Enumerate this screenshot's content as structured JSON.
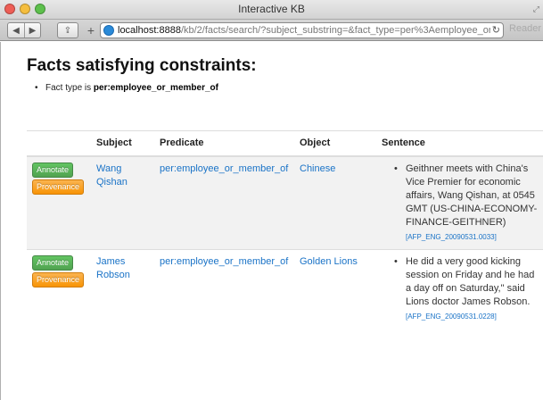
{
  "window": {
    "title": "Interactive KB"
  },
  "toolbar": {
    "back_icon": "◀",
    "forward_icon": "▶",
    "share_icon": "⇪",
    "add_tab_icon": "+",
    "url_host": "localhost:8888",
    "url_path": "/kb/2/facts/search/?subject_substring=&fact_type=per%3Aemployee_or_",
    "reload_icon": "↻",
    "reader_label": "Reader"
  },
  "page": {
    "heading": "Facts satisfying constraints:",
    "constraint_prefix": "Fact type is ",
    "constraint_value": "per:employee_or_member_of"
  },
  "table": {
    "headers": [
      "",
      "Subject",
      "Predicate",
      "Object",
      "Sentence"
    ],
    "rows": [
      {
        "annotate": "Annotate",
        "provenance": "Provenance",
        "subject": "Wang Qishan",
        "predicate": "per:employee_or_member_of",
        "object": "Chinese",
        "sentence": "Geithner meets with China's Vice Premier for economic affairs, Wang Qishan, at 0545 GMT (US-CHINA-ECONOMY-FINANCE-GEITHNER)",
        "doc": "[AFP_ENG_20090531.0033]"
      },
      {
        "annotate": "Annotate",
        "provenance": "Provenance",
        "subject": "James Robson",
        "predicate": "per:employee_or_member_of",
        "object": "Golden Lions",
        "sentence": "He did a very good kicking session on Friday and he had a day off on Saturday,\" said Lions doctor James Robson.",
        "doc": "[AFP_ENG_20090531.0228]"
      }
    ]
  },
  "colors": {
    "link": "#1a73c7",
    "annotate": "#5bb75b",
    "provenance": "#f89406"
  }
}
